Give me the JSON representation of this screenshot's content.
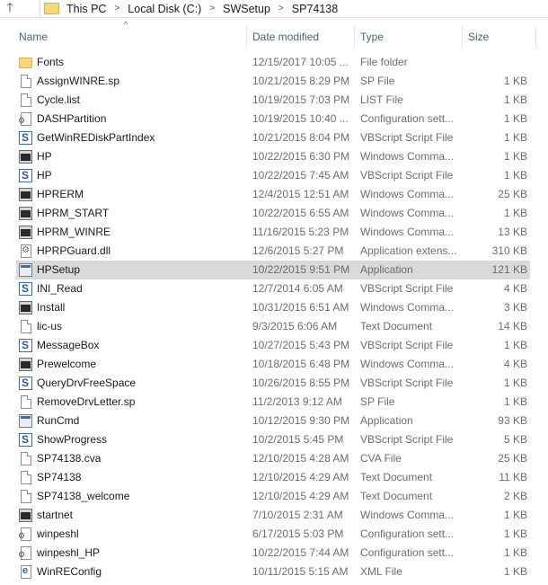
{
  "address_bar": {
    "up_icon": "up-arrow-icon",
    "crumbs": [
      "This PC",
      "Local Disk (C:)",
      "SWSetup",
      "SP74138"
    ]
  },
  "columns": {
    "name": "Name",
    "date_modified": "Date modified",
    "type": "Type",
    "size": "Size"
  },
  "selected_index": 11,
  "files": [
    {
      "name": "Fonts",
      "date": "12/15/2017 10:05 ...",
      "type": "File folder",
      "size": "",
      "icon": "folder"
    },
    {
      "name": "AssignWINRE.sp",
      "date": "10/21/2015 8:29 PM",
      "type": "SP File",
      "size": "1 KB",
      "icon": "file"
    },
    {
      "name": "Cycle.list",
      "date": "10/19/2015 7:03 PM",
      "type": "LIST File",
      "size": "1 KB",
      "icon": "file"
    },
    {
      "name": "DASHPartition",
      "date": "10/19/2015 10:40 ...",
      "type": "Configuration sett...",
      "size": "1 KB",
      "icon": "config"
    },
    {
      "name": "GetWinREDiskPartIndex",
      "date": "10/21/2015 8:04 PM",
      "type": "VBScript Script File",
      "size": "1 KB",
      "icon": "vbs"
    },
    {
      "name": "HP",
      "date": "10/22/2015 6:30 PM",
      "type": "Windows Comma...",
      "size": "1 KB",
      "icon": "cmd"
    },
    {
      "name": "HP",
      "date": "10/22/2015 7:45 AM",
      "type": "VBScript Script File",
      "size": "1 KB",
      "icon": "vbs"
    },
    {
      "name": "HPRERM",
      "date": "12/4/2015 12:51 AM",
      "type": "Windows Comma...",
      "size": "25 KB",
      "icon": "cmd"
    },
    {
      "name": "HPRM_START",
      "date": "10/22/2015 6:55 AM",
      "type": "Windows Comma...",
      "size": "1 KB",
      "icon": "cmd"
    },
    {
      "name": "HPRM_WINRE",
      "date": "11/16/2015 5:23 PM",
      "type": "Windows Comma...",
      "size": "13 KB",
      "icon": "cmd"
    },
    {
      "name": "HPRPGuard.dll",
      "date": "12/6/2015 5:27 PM",
      "type": "Application extens...",
      "size": "310 KB",
      "icon": "dll"
    },
    {
      "name": "HPSetup",
      "date": "10/22/2015 9:51 PM",
      "type": "Application",
      "size": "121 KB",
      "icon": "app"
    },
    {
      "name": "INI_Read",
      "date": "12/7/2014 6:05 AM",
      "type": "VBScript Script File",
      "size": "4 KB",
      "icon": "vbs"
    },
    {
      "name": "Install",
      "date": "10/31/2015 6:51 AM",
      "type": "Windows Comma...",
      "size": "3 KB",
      "icon": "cmd"
    },
    {
      "name": "lic-us",
      "date": "9/3/2015 6:06 AM",
      "type": "Text Document",
      "size": "14 KB",
      "icon": "file"
    },
    {
      "name": "MessageBox",
      "date": "10/27/2015 5:43 PM",
      "type": "VBScript Script File",
      "size": "1 KB",
      "icon": "vbs"
    },
    {
      "name": "Prewelcome",
      "date": "10/18/2015 6:48 PM",
      "type": "Windows Comma...",
      "size": "4 KB",
      "icon": "cmd"
    },
    {
      "name": "QueryDrvFreeSpace",
      "date": "10/26/2015 8:55 PM",
      "type": "VBScript Script File",
      "size": "1 KB",
      "icon": "vbs"
    },
    {
      "name": "RemoveDrvLetter.sp",
      "date": "11/2/2013 9:12 AM",
      "type": "SP File",
      "size": "1 KB",
      "icon": "file"
    },
    {
      "name": "RunCmd",
      "date": "10/12/2015 9:30 PM",
      "type": "Application",
      "size": "93 KB",
      "icon": "app"
    },
    {
      "name": "ShowProgress",
      "date": "10/2/2015 5:45 PM",
      "type": "VBScript Script File",
      "size": "5 KB",
      "icon": "vbs"
    },
    {
      "name": "SP74138.cva",
      "date": "12/10/2015 4:28 AM",
      "type": "CVA File",
      "size": "25 KB",
      "icon": "file"
    },
    {
      "name": "SP74138",
      "date": "12/10/2015 4:29 AM",
      "type": "Text Document",
      "size": "11 KB",
      "icon": "file"
    },
    {
      "name": "SP74138_welcome",
      "date": "12/10/2015 4:29 AM",
      "type": "Text Document",
      "size": "2 KB",
      "icon": "file"
    },
    {
      "name": "startnet",
      "date": "7/10/2015 2:31 AM",
      "type": "Windows Comma...",
      "size": "1 KB",
      "icon": "cmd"
    },
    {
      "name": "winpeshl",
      "date": "6/17/2015 5:03 PM",
      "type": "Configuration sett...",
      "size": "1 KB",
      "icon": "config"
    },
    {
      "name": "winpeshl_HP",
      "date": "10/22/2015 7:44 AM",
      "type": "Configuration sett...",
      "size": "1 KB",
      "icon": "config"
    },
    {
      "name": "WinREConfig",
      "date": "10/11/2015 5:15 AM",
      "type": "XML File",
      "size": "1 KB",
      "icon": "xml"
    }
  ]
}
